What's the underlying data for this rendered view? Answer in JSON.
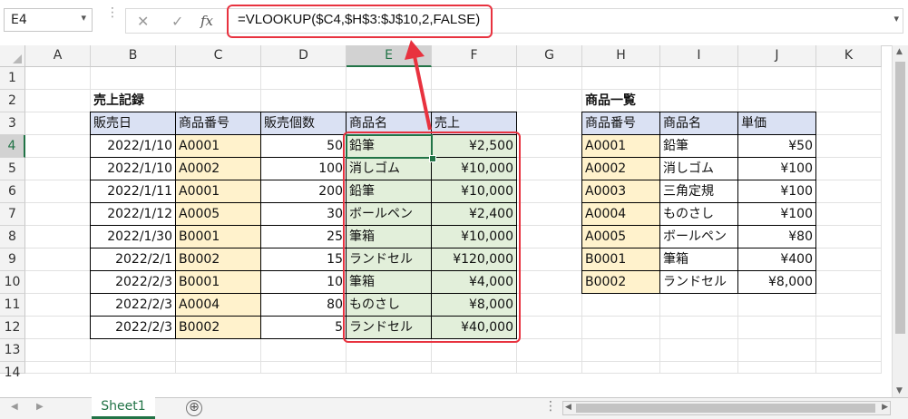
{
  "name_box": {
    "value": "E4"
  },
  "formula_bar": {
    "cancel_icon": "✕",
    "enter_icon": "✓",
    "fx_icon": "fx",
    "formula": "=VLOOKUP($C4,$H$3:$J$10,2,FALSE)"
  },
  "columns": [
    "A",
    "B",
    "C",
    "D",
    "E",
    "F",
    "G",
    "H",
    "I",
    "J",
    "K"
  ],
  "selected_column": "E",
  "rows": [
    "1",
    "2",
    "3",
    "4",
    "5",
    "6",
    "7",
    "8",
    "9",
    "10",
    "11",
    "12",
    "13",
    "14"
  ],
  "selected_row": "4",
  "sales": {
    "title": "売上記録",
    "headers": [
      "販売日",
      "商品番号",
      "販売個数",
      "商品名",
      "売上"
    ],
    "rows": [
      [
        "2022/1/10",
        "A0001",
        "50",
        "鉛筆",
        "¥2,500"
      ],
      [
        "2022/1/10",
        "A0002",
        "100",
        "消しゴム",
        "¥10,000"
      ],
      [
        "2022/1/11",
        "A0001",
        "200",
        "鉛筆",
        "¥10,000"
      ],
      [
        "2022/1/12",
        "A0005",
        "30",
        "ボールペン",
        "¥2,400"
      ],
      [
        "2022/1/30",
        "B0001",
        "25",
        "筆箱",
        "¥10,000"
      ],
      [
        "2022/2/1",
        "B0002",
        "15",
        "ランドセル",
        "¥120,000"
      ],
      [
        "2022/2/3",
        "B0001",
        "10",
        "筆箱",
        "¥4,000"
      ],
      [
        "2022/2/3",
        "A0004",
        "80",
        "ものさし",
        "¥8,000"
      ],
      [
        "2022/2/3",
        "B0002",
        "5",
        "ランドセル",
        "¥40,000"
      ]
    ]
  },
  "products": {
    "title": "商品一覧",
    "headers": [
      "商品番号",
      "商品名",
      "単価"
    ],
    "rows": [
      [
        "A0001",
        "鉛筆",
        "¥50"
      ],
      [
        "A0002",
        "消しゴム",
        "¥100"
      ],
      [
        "A0003",
        "三角定規",
        "¥100"
      ],
      [
        "A0004",
        "ものさし",
        "¥100"
      ],
      [
        "A0005",
        "ボールペン",
        "¥80"
      ],
      [
        "B0001",
        "筆箱",
        "¥400"
      ],
      [
        "B0002",
        "ランドセル",
        "¥8,000"
      ]
    ]
  },
  "sheet_tabs": [
    {
      "label": "Sheet1",
      "active": true
    }
  ],
  "add_sheet_icon": "⊕",
  "colors": {
    "accent": "#217346",
    "highlight": "#e8323f",
    "header_fill": "#dae1f3",
    "code_fill": "#fff2cc",
    "result_fill": "#e2efda"
  }
}
